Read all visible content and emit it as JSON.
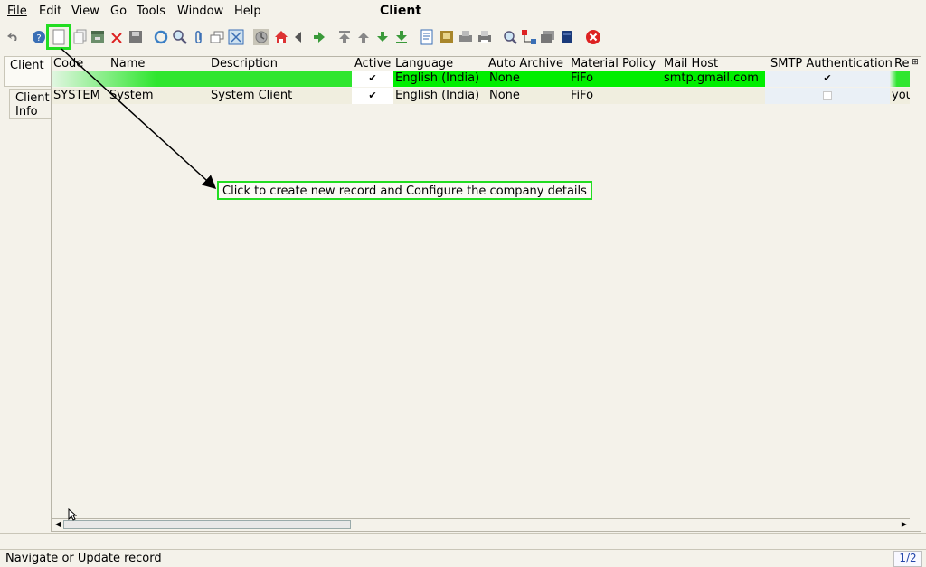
{
  "menu": {
    "file": "File",
    "edit": "Edit",
    "view": "View",
    "go": "Go",
    "tools": "Tools",
    "window": "Window",
    "help": "Help"
  },
  "window_title": "Client",
  "toolbar": {
    "icons": [
      "undo-icon",
      "help-icon",
      "new-record-icon",
      "copy-record-icon",
      "archive-icon",
      "delete-icon",
      "save-icon",
      "refresh-icon",
      "find-icon",
      "attachment-icon",
      "multi-view-icon",
      "grid-toggle-icon",
      "history-icon",
      "home-icon",
      "back-icon",
      "forward-icon",
      "first-record-icon",
      "previous-record-icon",
      "next-record-icon",
      "last-record-icon",
      "report-icon",
      "archived-docs-icon",
      "print-preview-icon",
      "print-icon",
      "zoom-across-icon",
      "workflow-icon",
      "request-icon",
      "product-info-icon",
      "close-icon"
    ]
  },
  "tabs": {
    "client": "Client",
    "client_info_1": "Client",
    "client_info_2": "Info"
  },
  "grid": {
    "columns": [
      "Code",
      "Name",
      "Description",
      "Active",
      "Language",
      "Auto Archive",
      "Material Policy",
      "Mail Host",
      "SMTP Authentication",
      "Req"
    ],
    "rows": [
      {
        "code": "",
        "name": "",
        "description": "",
        "active": "✔",
        "language": "English (India)",
        "auto_archive": "None",
        "material_policy": "FiFo",
        "mail_host": "smtp.gmail.com",
        "smtp_auth": "✔",
        "req": ""
      },
      {
        "code": "SYSTEM",
        "name": "System",
        "description": "System Client",
        "active": "✔",
        "language": "English (India)",
        "auto_archive": "None",
        "material_policy": "FiFo",
        "mail_host": "",
        "smtp_auth": "",
        "req": "you"
      }
    ]
  },
  "annotation": {
    "text": "Click to create new record and Configure the company details"
  },
  "status": {
    "message": "Navigate or Update record",
    "record_count": "1/2"
  },
  "colors": {
    "highlight_green": "#00ee00",
    "annotation_border": "#22dd22",
    "close_red": "#dd2222"
  }
}
